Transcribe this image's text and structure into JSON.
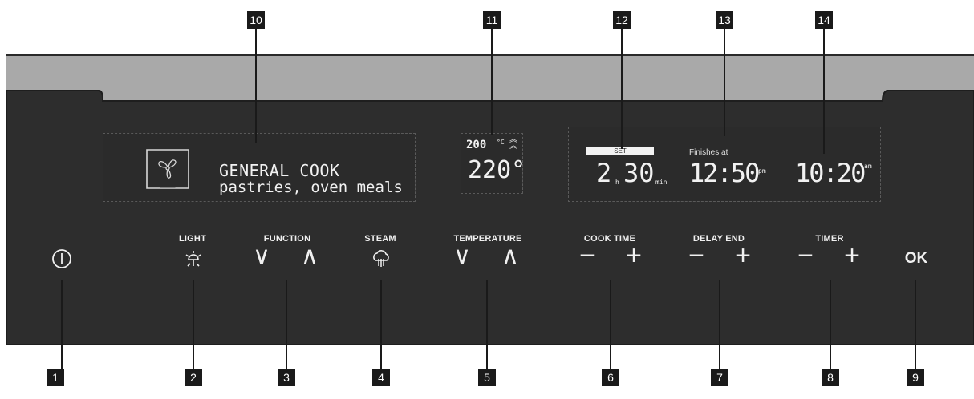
{
  "callouts": [
    "1",
    "2",
    "3",
    "4",
    "5",
    "6",
    "7",
    "8",
    "9",
    "10",
    "11",
    "12",
    "13",
    "14"
  ],
  "display_main": {
    "mode_title": "GENERAL COOK",
    "mode_subtitle": "pastries, oven meals",
    "mode_icon": "fan-icon"
  },
  "display_temp": {
    "current": "200",
    "current_unit": "°C",
    "set": "220°",
    "heating_icon": "double-chevron-up-icon"
  },
  "display_time": {
    "set_badge": "SET",
    "cook_hours": "2",
    "cook_hours_unit": "h",
    "cook_minutes": "30",
    "cook_minutes_unit": "min",
    "finishes_label": "Finishes at",
    "finish_time": "12:50",
    "finish_period": "pm",
    "clock_time": "10:20",
    "clock_period": "am"
  },
  "controls": {
    "light_label": "LIGHT",
    "function_label": "FUNCTION",
    "steam_label": "STEAM",
    "temperature_label": "TEMPERATURE",
    "cook_time_label": "COOK TIME",
    "delay_end_label": "DELAY END",
    "timer_label": "TIMER",
    "ok_label": "OK",
    "down_glyph": "∨",
    "up_glyph": "∧",
    "minus_glyph": "−",
    "plus_glyph": "+"
  },
  "colors": {
    "panel": "#2d2d2d",
    "strip": "#a9a9a9",
    "text": "#f0f0f0",
    "callout": "#1a1a1a"
  }
}
